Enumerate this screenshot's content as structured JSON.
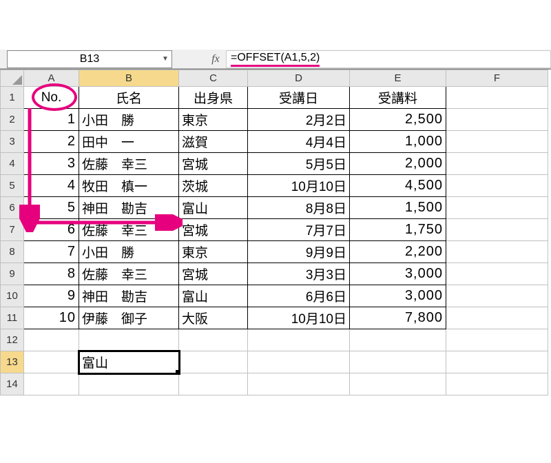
{
  "formula_bar": {
    "name_box": "B13",
    "fx_label": "fx",
    "formula": "=OFFSET(A1,5,2)"
  },
  "columns": [
    "A",
    "B",
    "C",
    "D",
    "E",
    "F"
  ],
  "headers": {
    "A": "No.",
    "B": "氏名",
    "C": "出身県",
    "D": "受講日",
    "E": "受講料"
  },
  "rows": [
    {
      "no": "1",
      "name": "小田　勝",
      "pref": "東京",
      "date": "2月2日",
      "fee": "2,500"
    },
    {
      "no": "2",
      "name": "田中　一",
      "pref": "滋賀",
      "date": "4月4日",
      "fee": "1,000"
    },
    {
      "no": "3",
      "name": "佐藤　幸三",
      "pref": "宮城",
      "date": "5月5日",
      "fee": "2,000"
    },
    {
      "no": "4",
      "name": "牧田　槙一",
      "pref": "茨城",
      "date": "10月10日",
      "fee": "4,500"
    },
    {
      "no": "5",
      "name": "神田　勘吉",
      "pref": "富山",
      "date": "8月8日",
      "fee": "1,500"
    },
    {
      "no": "6",
      "name": "佐藤　幸三",
      "pref": "宮城",
      "date": "7月7日",
      "fee": "1,750"
    },
    {
      "no": "7",
      "name": "小田　勝",
      "pref": "東京",
      "date": "9月9日",
      "fee": "2,200"
    },
    {
      "no": "8",
      "name": "佐藤　幸三",
      "pref": "宮城",
      "date": "3月3日",
      "fee": "3,000"
    },
    {
      "no": "9",
      "name": "神田　勘吉",
      "pref": "富山",
      "date": "6月6日",
      "fee": "3,000"
    },
    {
      "no": "10",
      "name": "伊藤　御子",
      "pref": "大阪",
      "date": "10月10日",
      "fee": "7,800"
    }
  ],
  "result_cell": {
    "ref": "B13",
    "value": "富山"
  },
  "chart_data": {
    "type": "table",
    "title": "OFFSET example",
    "columns": [
      "No.",
      "氏名",
      "出身県",
      "受講日",
      "受講料"
    ],
    "data": [
      [
        1,
        "小田 勝",
        "東京",
        "2月2日",
        2500
      ],
      [
        2,
        "田中 一",
        "滋賀",
        "4月4日",
        1000
      ],
      [
        3,
        "佐藤 幸三",
        "宮城",
        "5月5日",
        2000
      ],
      [
        4,
        "牧田 槙一",
        "茨城",
        "10月10日",
        4500
      ],
      [
        5,
        "神田 勘吉",
        "富山",
        "8月8日",
        1500
      ],
      [
        6,
        "佐藤 幸三",
        "宮城",
        "7月7日",
        1750
      ],
      [
        7,
        "小田 勝",
        "東京",
        "9月9日",
        2200
      ],
      [
        8,
        "佐藤 幸三",
        "宮城",
        "3月3日",
        3000
      ],
      [
        9,
        "神田 勘吉",
        "富山",
        "6月6日",
        3000
      ],
      [
        10,
        "伊藤 御子",
        "大阪",
        "10月10日",
        7800
      ]
    ],
    "formula_in_B13": "=OFFSET(A1,5,2)",
    "result": "富山"
  }
}
